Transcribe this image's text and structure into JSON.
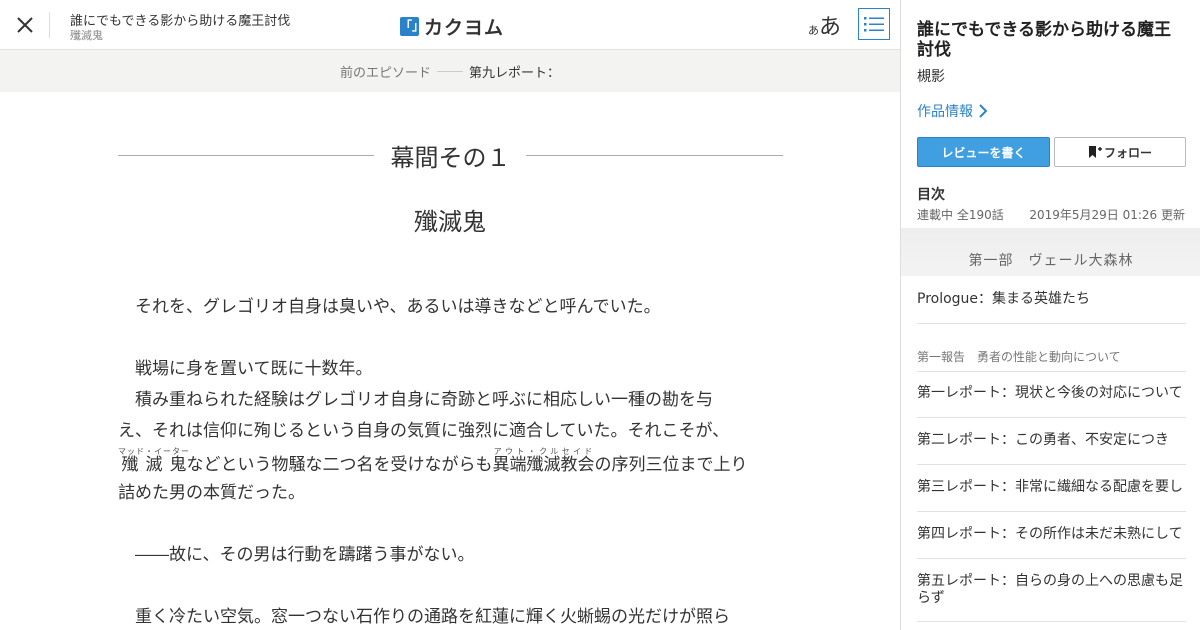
{
  "header": {
    "work_title": "誰にでもできる影から助ける魔王討伐",
    "work_author": "殲滅鬼",
    "logo_mark": "「」",
    "logo_text": "カクヨム",
    "font_small": "あ",
    "font_big": "あ",
    "close_icon": "close-icon",
    "toc_icon": "list-icon"
  },
  "nav": {
    "prev_label": "前のエピソード",
    "current_label": "第九レポート："
  },
  "reader": {
    "chapter_title": "幕間その１",
    "episode_title": "殲滅鬼",
    "p1": "　それを、グレゴリオ自身は臭いや、あるいは導きなどと呼んでいた。",
    "p2": "　戦場に身を置いて既に十数年。",
    "p3": "　積み重ねられた経験はグレゴリオ自身に奇跡と呼ぶに相応しい一種の勘を与",
    "p4": "え、それは信仰に殉じるという自身の気質に強烈に適合していた。それこそが、",
    "p5_ruby1_base": "殲滅鬼",
    "p5_ruby1_rt": "マッド・イーター",
    "p5_mid": "などという物騒な二つ名を受けながらも",
    "p5_ruby2_base": "異端殲滅教会",
    "p5_ruby2_rt": "アウト・クルセイド",
    "p5_end": "の序列三位まで上り",
    "p6": "詰めた男の本質だった。",
    "p7": "　――故に、その男は行動を躊躇う事がない。",
    "p8": "　重く冷たい空気。窓一つない石作りの通路を紅蓮に輝く火蜥蜴の光だけが照ら"
  },
  "side": {
    "title": "誰にでもできる影から助ける魔王討伐",
    "author": "槻影",
    "info_link": "作品情報",
    "review_button": "レビューを書く",
    "follow_button": "フォロー",
    "toc_heading": "目次",
    "toc_status": "連載中 全190話",
    "toc_updated": "2019年5月29日 01:26 更新",
    "part_title": "第一部　ヴェール大森林",
    "prologue": "Prologue：集まる英雄たち",
    "section1": "第一報告　勇者の性能と動向について",
    "items": [
      "第一レポート：現状と今後の対応について",
      "第二レポート：この勇者、不安定につき",
      "第三レポート：非常に繊細なる配慮を要し",
      "第四レポート：その所作は未だ未熟にして",
      "第五レポート：自らの身の上への思慮も足らず"
    ],
    "accent_color": "#2a83c8"
  }
}
